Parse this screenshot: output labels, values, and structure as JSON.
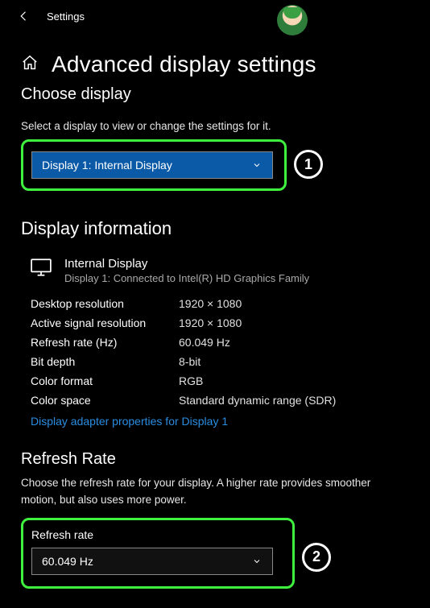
{
  "header": {
    "title": "Settings"
  },
  "page": {
    "title": "Advanced display settings",
    "choose_heading": "Choose display",
    "choose_sub": "Select a display to view or change the settings for it.",
    "dropdown_value": "Display 1: Internal Display"
  },
  "info": {
    "heading": "Display information",
    "display_name": "Internal Display",
    "display_sub": "Display 1: Connected to Intel(R) HD Graphics Family",
    "rows": [
      {
        "label": "Desktop resolution",
        "value": "1920 × 1080"
      },
      {
        "label": "Active signal resolution",
        "value": "1920 × 1080"
      },
      {
        "label": "Refresh rate (Hz)",
        "value": "60.049 Hz"
      },
      {
        "label": "Bit depth",
        "value": "8-bit"
      },
      {
        "label": "Color format",
        "value": "RGB"
      },
      {
        "label": "Color space",
        "value": "Standard dynamic range (SDR)"
      }
    ],
    "link": "Display adapter properties for Display 1"
  },
  "refresh": {
    "heading": "Refresh Rate",
    "sub": "Choose the refresh rate for your display. A higher rate provides smoother motion, but also uses more power.",
    "label": "Refresh rate",
    "value": "60.049 Hz"
  },
  "callouts": {
    "one": "1",
    "two": "2"
  }
}
